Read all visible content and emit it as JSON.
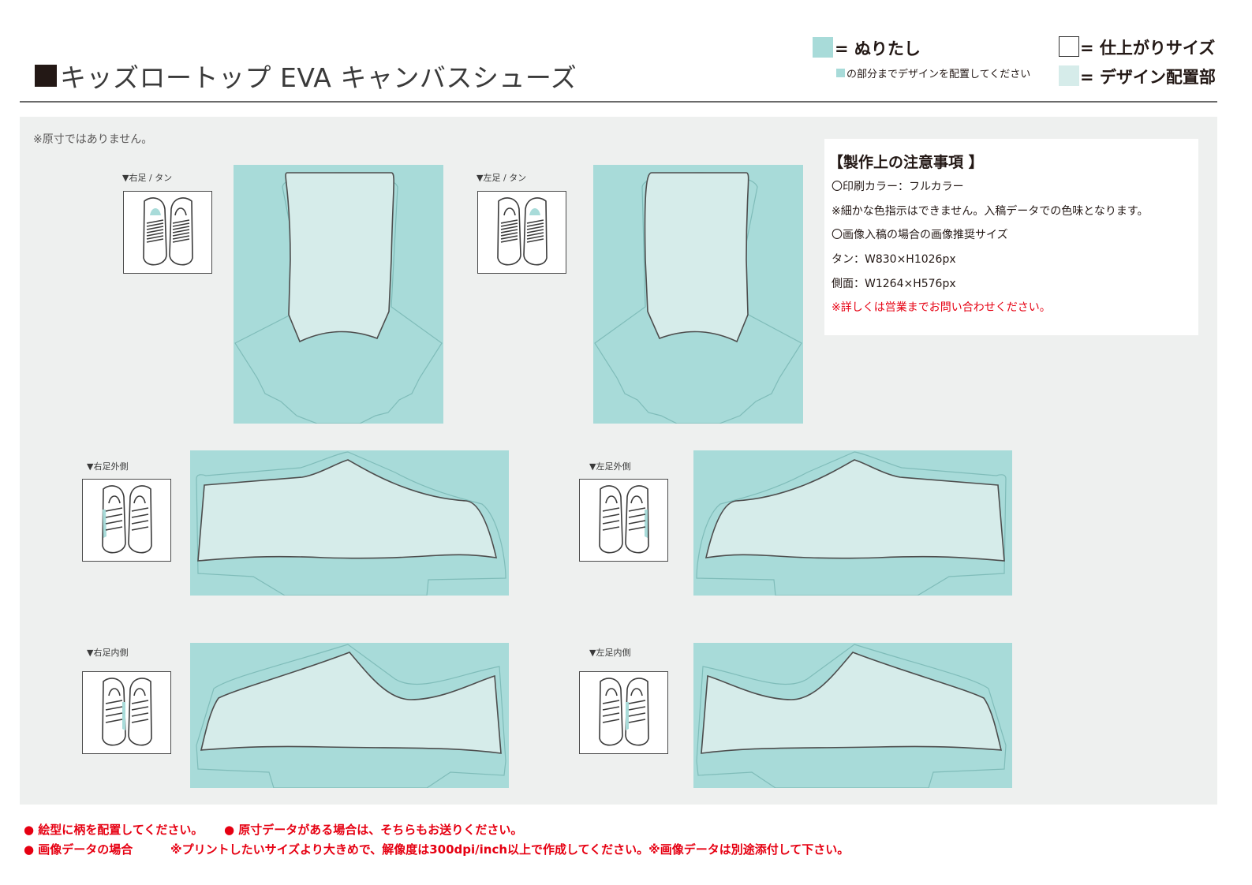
{
  "header": {
    "title": "キッズロートップ EVA キャンバスシューズ"
  },
  "legend": {
    "bleed_label": "= ぬりたし",
    "bleed_note": "の部分までデザインを配置してください",
    "finish_label": "= 仕上がりサイズ",
    "design_label": "= デザイン配置部",
    "colors": {
      "bleed": "#a8dbd9",
      "design": "#d6ecea",
      "outline": "#4d4d4d"
    }
  },
  "main": {
    "scale_note": "※原寸ではありません。",
    "views": [
      {
        "label": "▼右足 / タン"
      },
      {
        "label": "▼左足 / タン"
      },
      {
        "label": "▼右足外側"
      },
      {
        "label": "▼左足外側"
      },
      {
        "label": "▼右足内側"
      },
      {
        "label": "▼左足内側"
      }
    ]
  },
  "notes": {
    "title": "【製作上の注意事項 】",
    "lines": [
      "〇印刷カラー：フルカラー",
      "※細かな色指示はできません。入稿データでの色味となります。",
      "〇画像入稿の場合の画像推奨サイズ",
      "タン：W830×H1026px",
      "側面：W1264×H576px"
    ],
    "contact": "※詳しくは営業までお問い合わせください。"
  },
  "footer": {
    "line1_a": "● 絵型に柄を配置してください。",
    "line1_b": "● 原寸データがある場合は、そちらもお送りください。",
    "line2_a": "● 画像データの場合",
    "line2_b": "※プリントしたいサイズより大きめで、解像度は300dpi/inch以上で作成してください。※画像データは別途添付して下さい。"
  }
}
